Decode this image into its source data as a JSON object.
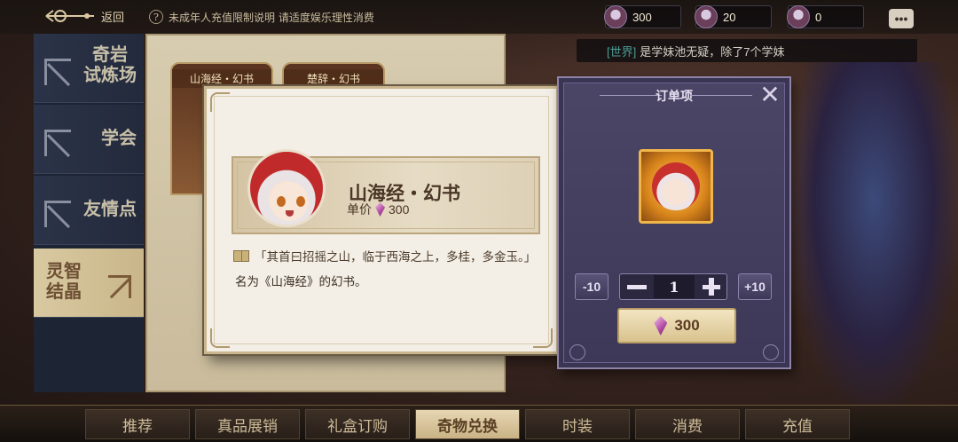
{
  "topbar": {
    "back_label": "返回",
    "notice_icon": "?",
    "notice_text": "未成年人充值限制说明  请适度娱乐理性消费",
    "currencies": [
      {
        "icon": "character-avatar-icon",
        "value": "300"
      },
      {
        "icon": "character-avatar-icon",
        "value": "20"
      },
      {
        "icon": "character-avatar-icon",
        "value": "0"
      }
    ],
    "chat_icon": "chat-bubble-icon"
  },
  "world_chat": {
    "tag": "[世界]",
    "message": "是学妹池无疑，除了7个学妹"
  },
  "left_nav": {
    "items": [
      {
        "label_line1": "奇岩",
        "label_line2": "试炼场",
        "active": false
      },
      {
        "label_line1": "学会",
        "label_line2": "",
        "active": false
      },
      {
        "label_line1": "友情点",
        "label_line2": "",
        "active": false
      },
      {
        "label_line1": "灵智",
        "label_line2": "结晶",
        "active": true
      }
    ]
  },
  "shop": {
    "cards": [
      {
        "title": "山海经・幻书"
      },
      {
        "title": "楚辞・幻书"
      }
    ]
  },
  "dialog": {
    "item_name": "山海经・幻书",
    "price_label": "单价",
    "price": "300",
    "quote": "「其首曰招摇之山，临于西海之上，多桂，多金玉。」",
    "description": "名为《山海经》的幻书。"
  },
  "order": {
    "title": "订单项",
    "minus10": "-10",
    "plus10": "+10",
    "quantity": "1",
    "total": "300"
  },
  "bottom_tabs": [
    {
      "label": "推荐",
      "active": false
    },
    {
      "label": "真品展销",
      "active": false
    },
    {
      "label": "礼盒订购",
      "active": false
    },
    {
      "label": "奇物兑换",
      "active": true
    },
    {
      "label": "时装",
      "active": false
    },
    {
      "label": "消费",
      "active": false
    },
    {
      "label": "充值",
      "active": false
    }
  ],
  "colors": {
    "accent_gold": "#d8c28e",
    "panel_purple": "#4b4566",
    "nav_active": "#d9c9a1"
  }
}
